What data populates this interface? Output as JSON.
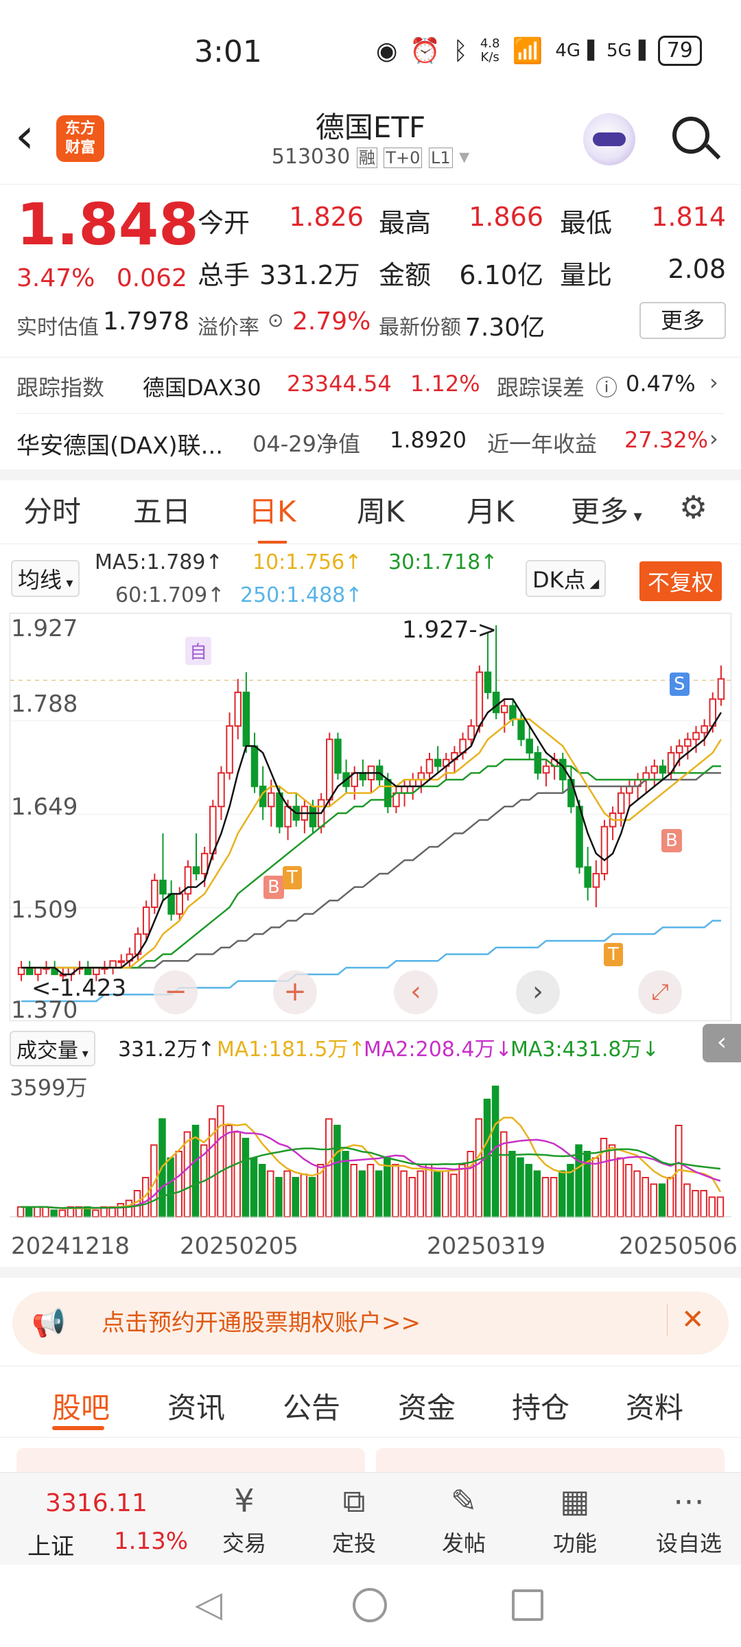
{
  "status_bar": {
    "time": "3:01",
    "net_speed": "4.8\nK/s",
    "battery": "79"
  },
  "header": {
    "title": "德国ETF",
    "code": "513030",
    "badges": [
      "融",
      "T+0",
      "L1"
    ],
    "logo_text": "东方\n财富"
  },
  "quote": {
    "price": "1.848",
    "change_pct": "3.47%",
    "change": "0.062",
    "open_label": "今开",
    "open": "1.826",
    "high_label": "最高",
    "high": "1.866",
    "low_label": "最低",
    "low": "1.814",
    "volume_label": "总手",
    "volume": "331.2万",
    "amount_label": "金额",
    "amount": "6.10亿",
    "ratio_label": "量比",
    "ratio": "2.08",
    "iopv_label": "实时估值",
    "iopv": "1.7978",
    "premium_label": "溢价率",
    "premium": "2.79%",
    "shares_label": "最新份额",
    "shares": "7.30亿",
    "more_label": "更多"
  },
  "tracking": {
    "label": "跟踪指数",
    "index": "德国DAX30",
    "index_value": "23344.54",
    "index_pct": "1.12%",
    "error_label": "跟踪误差",
    "error": "0.47%",
    "fund": "华安德国(DAX)联...",
    "nav_label": "04-29净值",
    "nav": "1.8920",
    "year_label": "近一年收益",
    "year_return": "27.32%"
  },
  "chart_tabs": [
    "分时",
    "五日",
    "日K",
    "周K",
    "月K",
    "更多"
  ],
  "active_tab": "日K",
  "ma_legend": {
    "selector": "均线",
    "ma5": "MA5:1.789↑",
    "ma10": "10:1.756↑",
    "ma30": "30:1.718↑",
    "ma60": "60:1.709↑",
    "ma250": "250:1.488↑",
    "dk": "DK点",
    "adjust": "不复权"
  },
  "colors": {
    "up": "#e0262c",
    "down": "#0c9a2c",
    "ma5": "#111111",
    "ma10": "#e8b21c",
    "ma30": "#1e9a2a",
    "ma60": "#666666",
    "ma250": "#58b4e8",
    "accent": "#f05a1a"
  },
  "chart_data": {
    "type": "candlestick",
    "y_ticks": [
      "1.927",
      "1.788",
      "1.649",
      "1.509",
      "1.370"
    ],
    "ylim": [
      1.37,
      1.927
    ],
    "max_marker": "1.927->",
    "min_marker": "<-1.423",
    "markers": [
      "自",
      "B",
      "T",
      "S",
      "B",
      "T"
    ],
    "x_ticks": [
      "20241218",
      "20250205",
      "20250319",
      "20250506"
    ],
    "volume_label": "成交量",
    "volume_value": "331.2万↑",
    "vol_ma1": "MA1:181.5万↑",
    "vol_ma2": "MA2:208.4万↓",
    "vol_ma3": "MA3:431.8万↓",
    "volume_max": "3599万",
    "ohlc": [
      [
        1.41,
        1.43,
        1.4,
        1.42
      ],
      [
        1.42,
        1.43,
        1.41,
        1.41
      ],
      [
        1.41,
        1.42,
        1.4,
        1.42
      ],
      [
        1.42,
        1.43,
        1.41,
        1.42
      ],
      [
        1.42,
        1.43,
        1.41,
        1.41
      ],
      [
        1.41,
        1.42,
        1.4,
        1.41
      ],
      [
        1.41,
        1.42,
        1.4,
        1.42
      ],
      [
        1.42,
        1.43,
        1.41,
        1.42
      ],
      [
        1.42,
        1.43,
        1.41,
        1.41
      ],
      [
        1.41,
        1.42,
        1.4,
        1.42
      ],
      [
        1.42,
        1.43,
        1.41,
        1.42
      ],
      [
        1.42,
        1.43,
        1.41,
        1.43
      ],
      [
        1.43,
        1.44,
        1.42,
        1.43
      ],
      [
        1.43,
        1.45,
        1.42,
        1.44
      ],
      [
        1.44,
        1.48,
        1.43,
        1.47
      ],
      [
        1.47,
        1.52,
        1.46,
        1.51
      ],
      [
        1.51,
        1.56,
        1.5,
        1.55
      ],
      [
        1.55,
        1.62,
        1.52,
        1.53
      ],
      [
        1.53,
        1.55,
        1.49,
        1.5
      ],
      [
        1.5,
        1.54,
        1.49,
        1.53
      ],
      [
        1.53,
        1.58,
        1.52,
        1.57
      ],
      [
        1.57,
        1.62,
        1.55,
        1.56
      ],
      [
        1.56,
        1.6,
        1.54,
        1.59
      ],
      [
        1.59,
        1.67,
        1.58,
        1.66
      ],
      [
        1.66,
        1.72,
        1.64,
        1.71
      ],
      [
        1.71,
        1.8,
        1.7,
        1.78
      ],
      [
        1.78,
        1.85,
        1.76,
        1.83
      ],
      [
        1.83,
        1.86,
        1.74,
        1.75
      ],
      [
        1.75,
        1.77,
        1.68,
        1.69
      ],
      [
        1.69,
        1.72,
        1.64,
        1.66
      ],
      [
        1.66,
        1.7,
        1.63,
        1.68
      ],
      [
        1.68,
        1.69,
        1.62,
        1.63
      ],
      [
        1.63,
        1.67,
        1.61,
        1.66
      ],
      [
        1.66,
        1.68,
        1.63,
        1.64
      ],
      [
        1.64,
        1.67,
        1.62,
        1.66
      ],
      [
        1.66,
        1.67,
        1.62,
        1.63
      ],
      [
        1.63,
        1.68,
        1.62,
        1.67
      ],
      [
        1.67,
        1.77,
        1.66,
        1.76
      ],
      [
        1.76,
        1.77,
        1.7,
        1.71
      ],
      [
        1.71,
        1.73,
        1.68,
        1.69
      ],
      [
        1.69,
        1.72,
        1.67,
        1.71
      ],
      [
        1.71,
        1.73,
        1.69,
        1.7
      ],
      [
        1.7,
        1.72,
        1.68,
        1.72
      ],
      [
        1.72,
        1.73,
        1.69,
        1.7
      ],
      [
        1.7,
        1.71,
        1.65,
        1.66
      ],
      [
        1.66,
        1.69,
        1.65,
        1.68
      ],
      [
        1.68,
        1.7,
        1.66,
        1.69
      ],
      [
        1.69,
        1.71,
        1.67,
        1.7
      ],
      [
        1.7,
        1.72,
        1.68,
        1.71
      ],
      [
        1.71,
        1.74,
        1.7,
        1.73
      ],
      [
        1.73,
        1.75,
        1.71,
        1.72
      ],
      [
        1.72,
        1.74,
        1.7,
        1.73
      ],
      [
        1.73,
        1.75,
        1.71,
        1.74
      ],
      [
        1.74,
        1.77,
        1.73,
        1.76
      ],
      [
        1.76,
        1.79,
        1.75,
        1.78
      ],
      [
        1.78,
        1.87,
        1.77,
        1.86
      ],
      [
        1.86,
        1.92,
        1.82,
        1.83
      ],
      [
        1.83,
        1.93,
        1.79,
        1.8
      ],
      [
        1.8,
        1.82,
        1.77,
        1.81
      ],
      [
        1.81,
        1.82,
        1.78,
        1.79
      ],
      [
        1.79,
        1.8,
        1.75,
        1.76
      ],
      [
        1.76,
        1.78,
        1.73,
        1.74
      ],
      [
        1.74,
        1.75,
        1.7,
        1.71
      ],
      [
        1.71,
        1.73,
        1.69,
        1.72
      ],
      [
        1.72,
        1.74,
        1.7,
        1.73
      ],
      [
        1.73,
        1.74,
        1.68,
        1.7
      ],
      [
        1.7,
        1.72,
        1.65,
        1.66
      ],
      [
        1.66,
        1.67,
        1.56,
        1.57
      ],
      [
        1.57,
        1.6,
        1.52,
        1.54
      ],
      [
        1.54,
        1.58,
        1.51,
        1.56
      ],
      [
        1.56,
        1.64,
        1.55,
        1.63
      ],
      [
        1.63,
        1.66,
        1.61,
        1.65
      ],
      [
        1.65,
        1.69,
        1.63,
        1.68
      ],
      [
        1.68,
        1.7,
        1.66,
        1.69
      ],
      [
        1.69,
        1.71,
        1.67,
        1.7
      ],
      [
        1.7,
        1.72,
        1.68,
        1.71
      ],
      [
        1.71,
        1.73,
        1.69,
        1.72
      ],
      [
        1.72,
        1.73,
        1.7,
        1.71
      ],
      [
        1.71,
        1.75,
        1.7,
        1.74
      ],
      [
        1.74,
        1.76,
        1.72,
        1.75
      ],
      [
        1.75,
        1.77,
        1.73,
        1.76
      ],
      [
        1.76,
        1.78,
        1.74,
        1.77
      ],
      [
        1.77,
        1.79,
        1.75,
        1.78
      ],
      [
        1.78,
        1.83,
        1.77,
        1.82
      ],
      [
        1.82,
        1.87,
        1.81,
        1.85
      ]
    ],
    "volume": [
      3,
      3,
      3,
      3,
      2,
      2,
      3,
      3,
      3,
      2,
      3,
      3,
      4,
      5,
      8,
      12,
      22,
      30,
      18,
      20,
      26,
      28,
      22,
      30,
      34,
      28,
      26,
      24,
      18,
      16,
      14,
      12,
      14,
      12,
      13,
      12,
      16,
      30,
      28,
      20,
      16,
      14,
      16,
      14,
      18,
      16,
      14,
      12,
      14,
      16,
      14,
      14,
      13,
      16,
      20,
      30,
      36,
      40,
      26,
      20,
      18,
      16,
      14,
      12,
      12,
      14,
      16,
      22,
      20,
      18,
      24,
      22,
      18,
      16,
      14,
      12,
      10,
      10,
      12,
      28,
      10,
      8,
      8,
      6,
      6
    ],
    "ma5": [
      1.42,
      1.42,
      1.42,
      1.42,
      1.42,
      1.41,
      1.41,
      1.42,
      1.42,
      1.42,
      1.42,
      1.42,
      1.42,
      1.43,
      1.44,
      1.46,
      1.49,
      1.52,
      1.53,
      1.53,
      1.54,
      1.54,
      1.55,
      1.59,
      1.62,
      1.66,
      1.71,
      1.75,
      1.75,
      1.74,
      1.71,
      1.68,
      1.66,
      1.65,
      1.65,
      1.65,
      1.65,
      1.67,
      1.69,
      1.7,
      1.71,
      1.71,
      1.71,
      1.71,
      1.7,
      1.69,
      1.69,
      1.69,
      1.69,
      1.7,
      1.71,
      1.72,
      1.73,
      1.74,
      1.75,
      1.78,
      1.8,
      1.81,
      1.82,
      1.82,
      1.8,
      1.78,
      1.76,
      1.74,
      1.73,
      1.72,
      1.7,
      1.66,
      1.62,
      1.59,
      1.58,
      1.59,
      1.62,
      1.66,
      1.67,
      1.68,
      1.69,
      1.7,
      1.71,
      1.73,
      1.74,
      1.75,
      1.76,
      1.78,
      1.8
    ],
    "ma10": [
      1.42,
      1.42,
      1.42,
      1.42,
      1.42,
      1.42,
      1.42,
      1.42,
      1.42,
      1.42,
      1.42,
      1.42,
      1.42,
      1.42,
      1.43,
      1.44,
      1.45,
      1.47,
      1.48,
      1.49,
      1.51,
      1.52,
      1.53,
      1.55,
      1.57,
      1.59,
      1.62,
      1.64,
      1.66,
      1.68,
      1.69,
      1.69,
      1.68,
      1.68,
      1.67,
      1.66,
      1.66,
      1.66,
      1.67,
      1.68,
      1.68,
      1.68,
      1.68,
      1.69,
      1.69,
      1.69,
      1.7,
      1.7,
      1.7,
      1.7,
      1.7,
      1.71,
      1.71,
      1.72,
      1.73,
      1.74,
      1.76,
      1.77,
      1.78,
      1.79,
      1.79,
      1.79,
      1.78,
      1.77,
      1.76,
      1.75,
      1.73,
      1.71,
      1.69,
      1.67,
      1.65,
      1.64,
      1.64,
      1.64,
      1.65,
      1.66,
      1.67,
      1.68,
      1.69,
      1.7,
      1.71,
      1.72,
      1.73,
      1.74,
      1.76
    ],
    "ma30": [
      1.42,
      1.42,
      1.42,
      1.42,
      1.42,
      1.42,
      1.42,
      1.42,
      1.42,
      1.42,
      1.42,
      1.42,
      1.42,
      1.42,
      1.42,
      1.43,
      1.43,
      1.44,
      1.44,
      1.45,
      1.46,
      1.47,
      1.48,
      1.49,
      1.5,
      1.51,
      1.53,
      1.54,
      1.55,
      1.56,
      1.57,
      1.58,
      1.59,
      1.6,
      1.61,
      1.62,
      1.63,
      1.64,
      1.65,
      1.65,
      1.66,
      1.66,
      1.67,
      1.67,
      1.67,
      1.68,
      1.68,
      1.68,
      1.69,
      1.69,
      1.69,
      1.7,
      1.7,
      1.7,
      1.71,
      1.71,
      1.72,
      1.72,
      1.73,
      1.73,
      1.73,
      1.73,
      1.73,
      1.73,
      1.72,
      1.72,
      1.72,
      1.71,
      1.71,
      1.7,
      1.7,
      1.7,
      1.7,
      1.7,
      1.7,
      1.7,
      1.7,
      1.7,
      1.71,
      1.71,
      1.71,
      1.71,
      1.71,
      1.72,
      1.72
    ],
    "ma60": [
      1.42,
      1.42,
      1.42,
      1.42,
      1.42,
      1.42,
      1.42,
      1.42,
      1.42,
      1.42,
      1.42,
      1.42,
      1.42,
      1.42,
      1.42,
      1.42,
      1.42,
      1.43,
      1.43,
      1.43,
      1.43,
      1.44,
      1.44,
      1.44,
      1.45,
      1.45,
      1.46,
      1.46,
      1.47,
      1.47,
      1.48,
      1.48,
      1.49,
      1.49,
      1.5,
      1.5,
      1.51,
      1.52,
      1.52,
      1.53,
      1.54,
      1.54,
      1.55,
      1.56,
      1.56,
      1.57,
      1.58,
      1.58,
      1.59,
      1.6,
      1.6,
      1.61,
      1.62,
      1.62,
      1.63,
      1.64,
      1.64,
      1.65,
      1.66,
      1.66,
      1.67,
      1.67,
      1.68,
      1.68,
      1.68,
      1.68,
      1.69,
      1.69,
      1.69,
      1.69,
      1.69,
      1.69,
      1.69,
      1.69,
      1.69,
      1.7,
      1.7,
      1.7,
      1.7,
      1.7,
      1.7,
      1.7,
      1.71,
      1.71,
      1.71
    ],
    "ma250": [
      1.37,
      1.37,
      1.37,
      1.37,
      1.37,
      1.37,
      1.37,
      1.37,
      1.37,
      1.37,
      1.38,
      1.38,
      1.38,
      1.38,
      1.38,
      1.38,
      1.38,
      1.38,
      1.38,
      1.39,
      1.39,
      1.39,
      1.39,
      1.39,
      1.39,
      1.39,
      1.4,
      1.4,
      1.4,
      1.4,
      1.4,
      1.4,
      1.4,
      1.41,
      1.41,
      1.41,
      1.41,
      1.41,
      1.41,
      1.42,
      1.42,
      1.42,
      1.42,
      1.42,
      1.42,
      1.43,
      1.43,
      1.43,
      1.43,
      1.43,
      1.43,
      1.44,
      1.44,
      1.44,
      1.44,
      1.44,
      1.44,
      1.45,
      1.45,
      1.45,
      1.45,
      1.45,
      1.45,
      1.46,
      1.46,
      1.46,
      1.46,
      1.46,
      1.46,
      1.46,
      1.46,
      1.47,
      1.47,
      1.47,
      1.47,
      1.47,
      1.47,
      1.48,
      1.48,
      1.48,
      1.48,
      1.48,
      1.48,
      1.49,
      1.49
    ]
  },
  "banner": {
    "text": "点击预约开通股票期权账户>>"
  },
  "bottom_tabs": [
    "股吧",
    "资讯",
    "公告",
    "资金",
    "持仓",
    "资料"
  ],
  "bottom_active": "股吧",
  "market": {
    "index_value": "3316.11",
    "index_name": "上证",
    "index_pct": "1.13%"
  },
  "nav": [
    {
      "label": "交易",
      "icon": "yen-icon"
    },
    {
      "label": "定投",
      "icon": "chart-icon"
    },
    {
      "label": "发帖",
      "icon": "edit-icon"
    },
    {
      "label": "功能",
      "icon": "grid-icon"
    },
    {
      "label": "设自选",
      "icon": "more-icon"
    }
  ]
}
